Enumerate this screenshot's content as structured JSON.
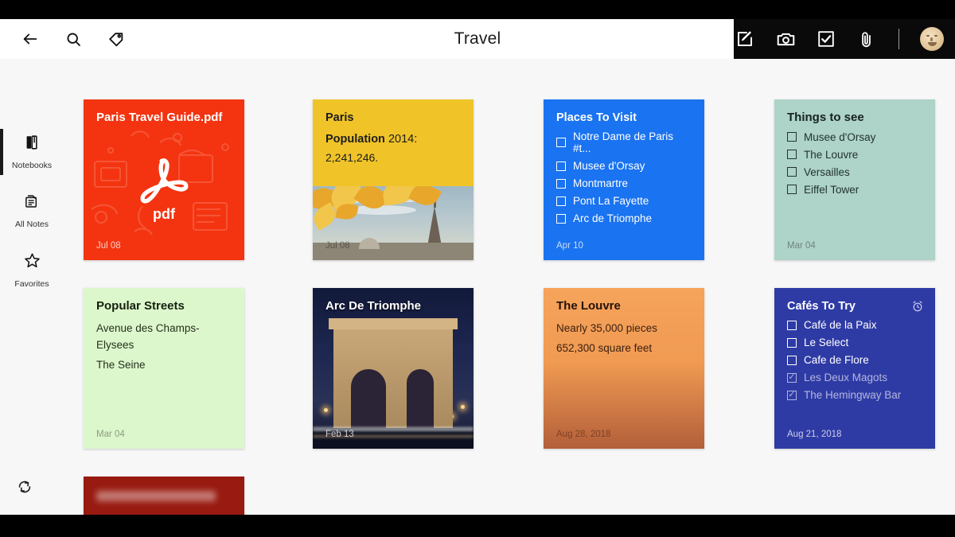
{
  "header": {
    "title": "Travel",
    "left_icons": [
      {
        "name": "back-arrow-icon",
        "label": "Back"
      },
      {
        "name": "search-icon",
        "label": "Search"
      },
      {
        "name": "tag-icon",
        "label": "Tags"
      }
    ],
    "right_icons": [
      {
        "name": "compose-note-icon",
        "label": "New Note"
      },
      {
        "name": "camera-icon",
        "label": "Camera Note"
      },
      {
        "name": "checkbox-icon",
        "label": "Checklist Note"
      },
      {
        "name": "paperclip-icon",
        "label": "Attachment"
      }
    ],
    "avatar_label": "Account"
  },
  "sidebar": {
    "items": [
      {
        "label": "Notebooks",
        "icon": "notebook-icon",
        "active": true
      },
      {
        "label": "All Notes",
        "icon": "all-notes-icon",
        "active": false
      },
      {
        "label": "Favorites",
        "icon": "star-icon",
        "active": false
      }
    ],
    "sync_label": "Sync"
  },
  "cards": {
    "pdf": {
      "title": "Paris Travel Guide.pdf",
      "glyph_label": "pdf",
      "date": "Jul 08",
      "color": "#f43410"
    },
    "paris": {
      "title": "Paris",
      "line_label": "Population",
      "line_year": " 2014:",
      "population": "2,241,246.",
      "date": "Jul 08",
      "color": "#f0c428"
    },
    "places": {
      "title": "Places To Visit",
      "items": [
        {
          "label": "Notre Dame de Paris #t...",
          "checked": false
        },
        {
          "label": "Musee d'Orsay",
          "checked": false
        },
        {
          "label": "Montmartre",
          "checked": false
        },
        {
          "label": "Pont La Fayette",
          "checked": false
        },
        {
          "label": "Arc de Triomphe",
          "checked": false
        }
      ],
      "date": "Apr 10",
      "color": "#1a73f0"
    },
    "things": {
      "title": "Things to see",
      "items": [
        {
          "label": "Musee d'Orsay",
          "checked": false
        },
        {
          "label": "The Louvre",
          "checked": false
        },
        {
          "label": "Versailles",
          "checked": false
        },
        {
          "label": "Eiffel Tower",
          "checked": false
        }
      ],
      "date": "Mar 04",
      "color": "#aed3c9"
    },
    "streets": {
      "title": "Popular Streets",
      "lines": [
        "Avenue des Champs-Elysees",
        "The Seine"
      ],
      "date": "Mar 04",
      "color": "#ddf7cd"
    },
    "arc": {
      "title": "Arc De Triomphe",
      "date": "Feb 13",
      "color": "#10142a"
    },
    "louvre": {
      "title": "The Louvre",
      "lines": [
        "Nearly 35,000 pieces",
        "652,300 square feet"
      ],
      "date": "Aug 28, 2018",
      "color": "#f09a52"
    },
    "cafes": {
      "title": "Cafés To Try",
      "reminder_icon": "alarm-clock-icon",
      "items": [
        {
          "label": "Café de la Paix",
          "checked": false
        },
        {
          "label": "Le Select",
          "checked": false
        },
        {
          "label": "Cafe de Flore",
          "checked": false
        },
        {
          "label": "Les Deux Magots",
          "checked": true
        },
        {
          "label": "The Hemingway Bar",
          "checked": true
        }
      ],
      "date": "Aug 21, 2018",
      "color": "#2f3ba5"
    },
    "partial": {
      "title": "",
      "color": "#981a10"
    }
  }
}
